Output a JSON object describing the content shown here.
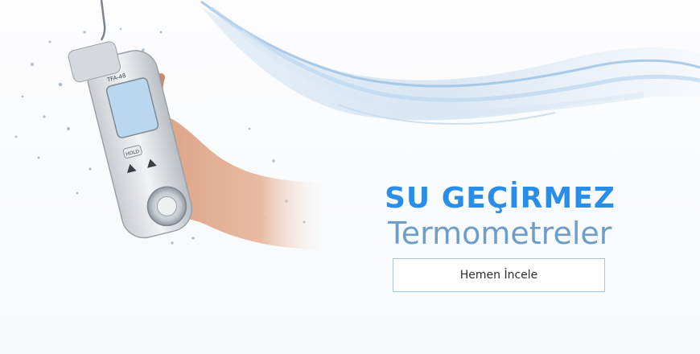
{
  "banner": {
    "headline": "SU GEÇİRMEZ",
    "subheadline": "Termometreler",
    "cta_label": "Hemen İncele",
    "device_label": "TFA-48",
    "hold_label": "HOLD",
    "accent_color": "#2a8ee8",
    "subheadline_color": "#6e9dc8",
    "button_border_color": "#a9c5e3"
  }
}
